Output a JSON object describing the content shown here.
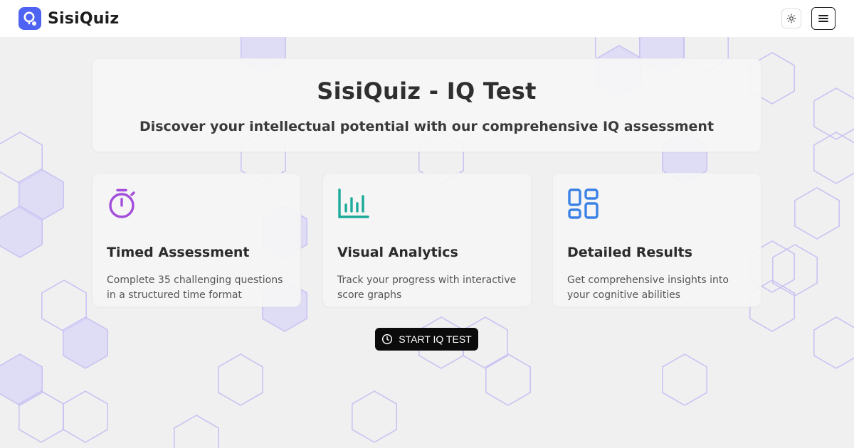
{
  "header": {
    "brand_name": "SisiQuiz",
    "logo_icon": "quiz-logo-icon",
    "theme_icon": "sun-icon",
    "menu_icon": "hamburger-menu-icon"
  },
  "hero": {
    "title": "SisiQuiz - IQ Test",
    "subtitle": "Discover your intellectual potential with our comprehensive IQ assessment"
  },
  "features": [
    {
      "icon": "stopwatch-icon",
      "icon_color": "#a24ddb",
      "title": "Timed Assessment",
      "description": "Complete 35 challenging questions in a structured time format"
    },
    {
      "icon": "bar-chart-icon",
      "icon_color": "#1aa99a",
      "title": "Visual Analytics",
      "description": "Track your progress with interactive score graphs"
    },
    {
      "icon": "grid-layout-icon",
      "icon_color": "#3b82e6",
      "title": "Detailed Results",
      "description": "Get comprehensive insights into your cognitive abilities"
    }
  ],
  "cta": {
    "label": "START IQ TEST",
    "icon": "clock-icon"
  },
  "colors": {
    "brand": "#4f63f2",
    "hex_outline": "#c9c4f2",
    "hex_fill": "#dad6f7",
    "cta_bg": "#0b0b0b"
  }
}
